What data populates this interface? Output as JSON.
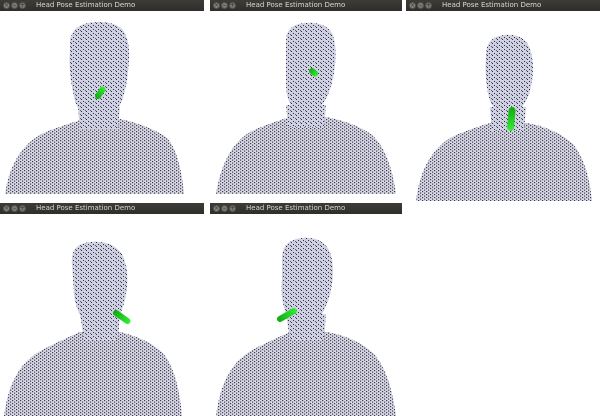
{
  "windows": [
    {
      "title": "Head Pose Estimation Demo",
      "view": "pointcloud-head-front-pose"
    },
    {
      "title": "Head Pose Estimation Demo",
      "view": "pointcloud-head-front-pose"
    },
    {
      "title": "Head Pose Estimation Demo",
      "view": "pointcloud-head-down-pose"
    },
    {
      "title": "Head Pose Estimation Demo",
      "view": "pointcloud-head-left-pose"
    },
    {
      "title": "Head Pose Estimation Demo",
      "view": "pointcloud-head-right-pose"
    }
  ],
  "colors": {
    "titlebar": "#3d3c38",
    "title_text": "#dcdad2",
    "pointcloud": "#3a3a50",
    "pointcloud_light": "#c8c8dc",
    "pose_vector": "#1fd51f"
  },
  "icons": [
    "close-icon",
    "minimize-icon",
    "maximize-icon"
  ]
}
